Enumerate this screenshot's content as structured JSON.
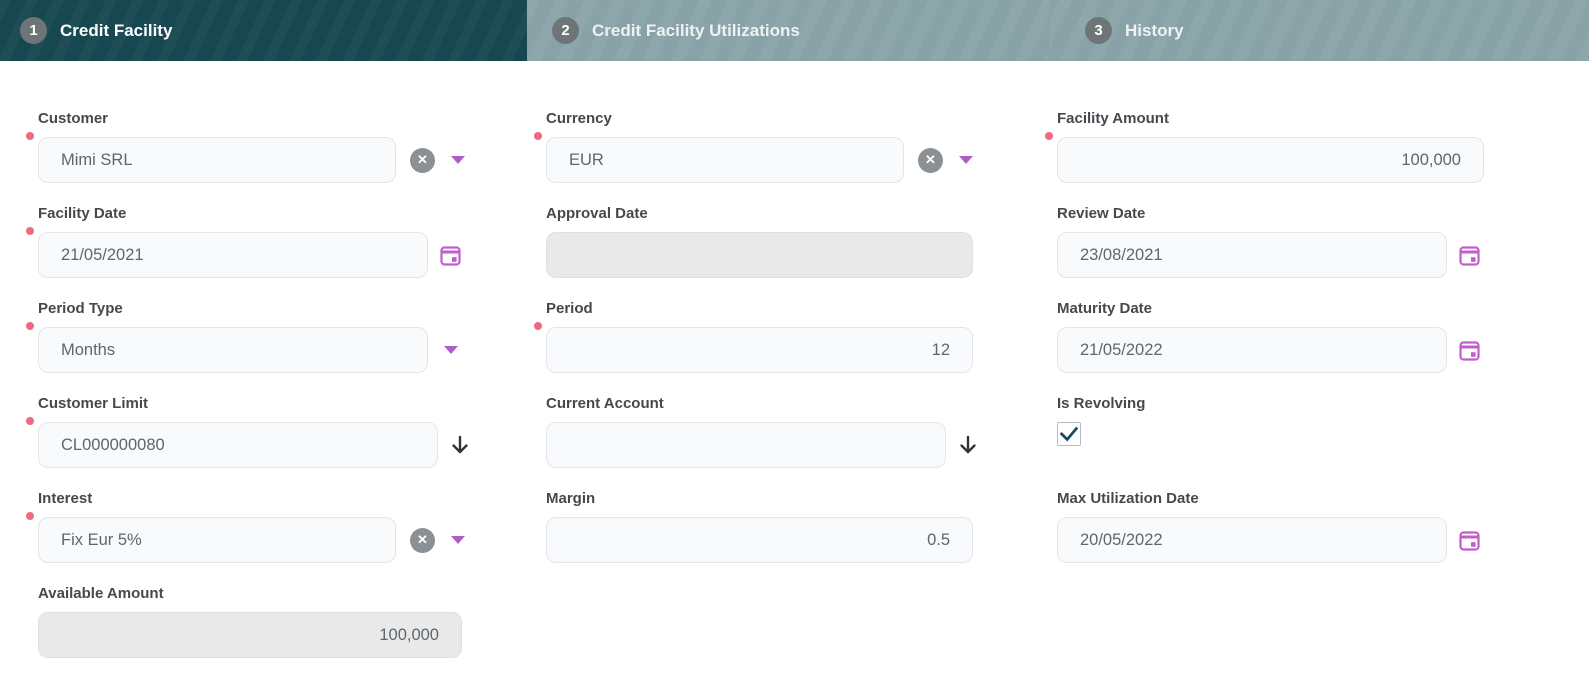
{
  "stepper": {
    "steps": [
      {
        "number": "1",
        "label": "Credit Facility",
        "active": true
      },
      {
        "number": "2",
        "label": "Credit Facility Utilizations",
        "active": false
      },
      {
        "number": "3",
        "label": "History",
        "active": false
      }
    ]
  },
  "form": {
    "customer": {
      "label": "Customer",
      "value": "Mimi SRL",
      "required": true
    },
    "currency": {
      "label": "Currency",
      "value": "EUR",
      "required": true
    },
    "facility_amount": {
      "label": "Facility Amount",
      "value": "100,000",
      "required": true
    },
    "facility_date": {
      "label": "Facility Date",
      "value": "21/05/2021",
      "required": true
    },
    "approval_date": {
      "label": "Approval Date",
      "value": "",
      "disabled": true
    },
    "review_date": {
      "label": "Review Date",
      "value": "23/08/2021"
    },
    "period_type": {
      "label": "Period Type",
      "value": "Months",
      "required": true
    },
    "period": {
      "label": "Period",
      "value": "12",
      "required": true
    },
    "maturity_date": {
      "label": "Maturity Date",
      "value": "21/05/2022"
    },
    "customer_limit": {
      "label": "Customer Limit",
      "value": "CL000000080",
      "required": true
    },
    "current_account": {
      "label": "Current Account",
      "value": ""
    },
    "is_revolving": {
      "label": "Is Revolving",
      "checked": true
    },
    "interest": {
      "label": "Interest",
      "value": "Fix Eur 5%",
      "required": true
    },
    "margin": {
      "label": "Margin",
      "value": "0.5"
    },
    "max_utilization_date": {
      "label": "Max Utilization Date",
      "value": "20/05/2022"
    },
    "available_amount": {
      "label": "Available Amount",
      "value": "100,000",
      "disabled": true
    }
  },
  "icons": {
    "clear": "✕",
    "names": [
      "clear-circle-icon",
      "chevron-down-icon",
      "calendar-icon",
      "down-arrow-lookup-icon",
      "checkbox-check-icon"
    ]
  },
  "colors": {
    "header_teal": "#174750",
    "tab_gray": "#88a2a7",
    "step_circle": "#6e7577",
    "accent_purple": "#af5ec8",
    "calendar_purple": "#c05ecb",
    "required_red": "#f0697f",
    "label_color": "#45494e",
    "input_text": "#5f666d",
    "input_bg": "#f8fafc",
    "input_border": "#e2e6eb",
    "disabled_bg": "#e9e9e9",
    "check_color": "#1b4a60"
  }
}
